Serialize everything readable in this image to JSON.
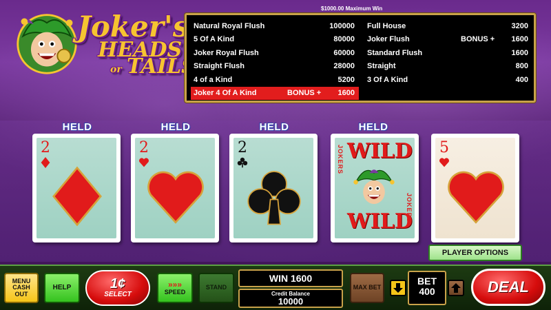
{
  "logo": {
    "line1": "Joker's",
    "line2": "HEADS",
    "or": "or",
    "line3": "TAILS"
  },
  "paytable": {
    "max_win": "$1000.00 Maximum Win",
    "left": [
      {
        "name": "Natural Royal Flush",
        "bonus": "",
        "pay": "100000"
      },
      {
        "name": "5 Of A Kind",
        "bonus": "",
        "pay": "80000"
      },
      {
        "name": "Joker Royal Flush",
        "bonus": "",
        "pay": "60000"
      },
      {
        "name": "Straight Flush",
        "bonus": "",
        "pay": "28000"
      },
      {
        "name": "4 of a Kind",
        "bonus": "",
        "pay": "5200"
      },
      {
        "name": "Joker 4 Of A Kind",
        "bonus": "BONUS +",
        "pay": "1600"
      }
    ],
    "right": [
      {
        "name": "Full House",
        "bonus": "",
        "pay": "3200"
      },
      {
        "name": "Joker Flush",
        "bonus": "BONUS +",
        "pay": "1600"
      },
      {
        "name": "Standard Flush",
        "bonus": "",
        "pay": "1600"
      },
      {
        "name": "Straight",
        "bonus": "",
        "pay": "800"
      },
      {
        "name": "3 Of A Kind",
        "bonus": "",
        "pay": "400"
      }
    ],
    "highlight_color": "#e21d1d"
  },
  "cards": [
    {
      "held_label": "HELD",
      "rank": "2",
      "suit": "diamond",
      "color": "red",
      "held": true
    },
    {
      "held_label": "HELD",
      "rank": "2",
      "suit": "heart",
      "color": "red",
      "held": true
    },
    {
      "held_label": "HELD",
      "rank": "2",
      "suit": "club",
      "color": "black",
      "held": true
    },
    {
      "held_label": "HELD",
      "rank": "WILD",
      "wild_top": "WILD",
      "wild_bottom": "WILD",
      "side_text": "JOKERS",
      "suit": "joker",
      "held": true
    },
    {
      "held_label": "",
      "rank": "5",
      "suit": "heart",
      "color": "red",
      "held": false
    }
  ],
  "player_options": "PLAYER OPTIONS",
  "controls": {
    "menu": "MENU CASH OUT",
    "help": "HELP",
    "select_big": "1¢",
    "select_small": "SELECT",
    "speed": "SPEED",
    "speed_arrows": "»»»",
    "stand": "STAND",
    "win": "WIN 1600",
    "credit_label": "Credit Balance",
    "credit_value": "10000",
    "max_bet": "MAX BET",
    "bet_label": "BET",
    "bet_value": "400",
    "deal": "DEAL"
  }
}
